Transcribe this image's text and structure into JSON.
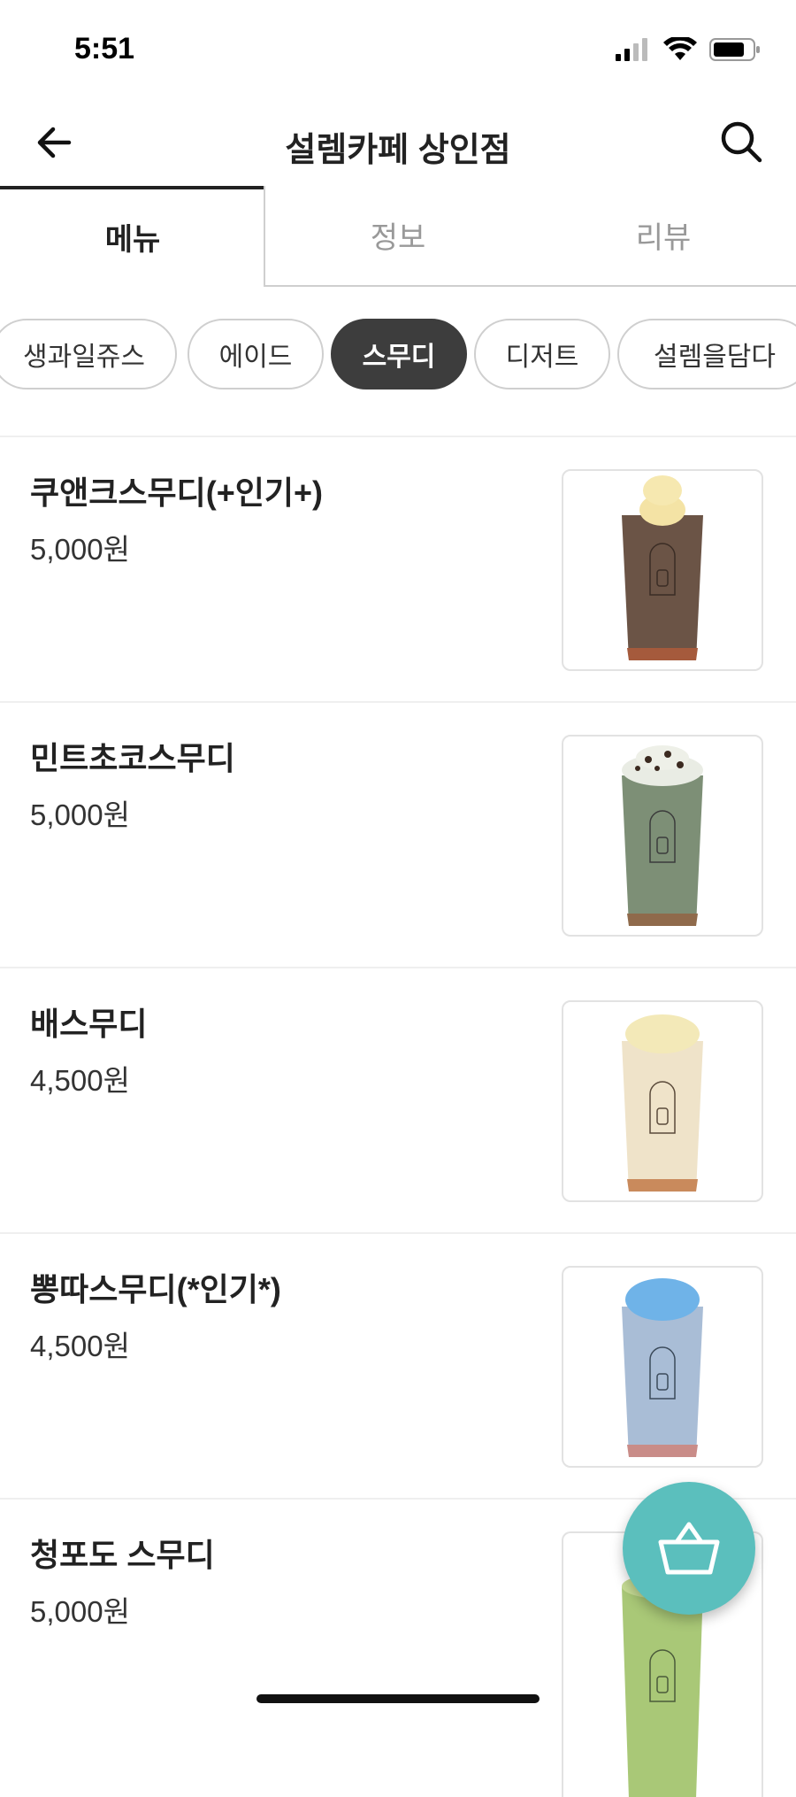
{
  "status_bar": {
    "time": "5:51"
  },
  "header": {
    "title": "설렘카페 상인점",
    "back_icon": "arrow-left-icon",
    "search_icon": "search-icon"
  },
  "tabs": [
    {
      "label": "메뉴",
      "active": true
    },
    {
      "label": "정보",
      "active": false
    },
    {
      "label": "리뷰",
      "active": false
    }
  ],
  "categories": [
    {
      "label": "생과일쥬스",
      "active": false
    },
    {
      "label": "에이드",
      "active": false
    },
    {
      "label": "스무디",
      "active": true
    },
    {
      "label": "디저트",
      "active": false
    },
    {
      "label": "설렘을담다",
      "active": false
    }
  ],
  "menu_items": [
    {
      "name": "쿠앤크스무디(+인기+)",
      "price": "5,000원",
      "drink_color": "#6b5446",
      "topping": "ice-cream"
    },
    {
      "name": "민트초코스무디",
      "price": "5,000원",
      "drink_color": "#7d8f76",
      "topping": "choco-chips"
    },
    {
      "name": "배스무디",
      "price": "4,500원",
      "drink_color": "#efe3c9",
      "topping": "ice"
    },
    {
      "name": "뽕따스무디(*인기*)",
      "price": "4,500원",
      "drink_color": "#a9bdd6",
      "topping": "blue-ice"
    },
    {
      "name": "청포도 스무디",
      "price": "5,000원",
      "drink_color": "#a9c877",
      "topping": "none"
    }
  ],
  "cart_button": {
    "icon": "basket-icon",
    "color": "#5bbfbd"
  },
  "colors": {
    "active_chip": "#3d3d3d",
    "accent": "#5bbfbd"
  }
}
